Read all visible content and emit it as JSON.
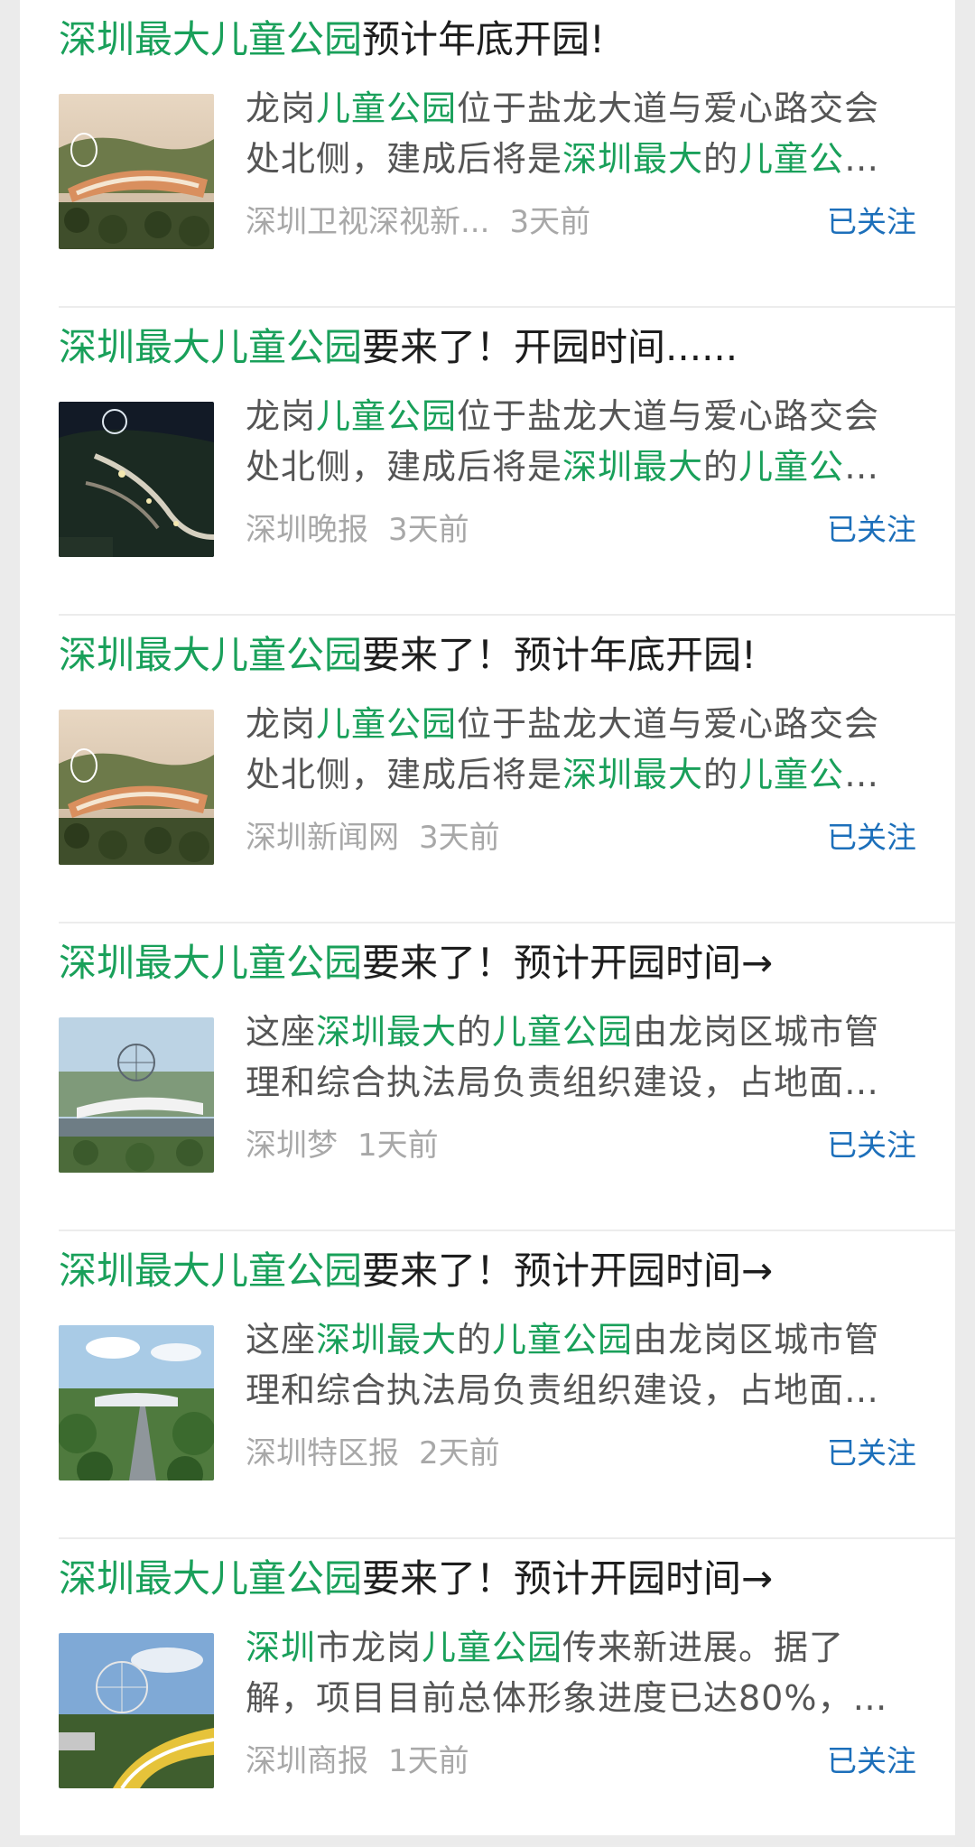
{
  "colors": {
    "highlight": "#19a05a",
    "follow": "#1c6fba",
    "source": "#a8a8a8"
  },
  "results": [
    {
      "title": {
        "highlight": "深圳最大儿童公园",
        "rest": "预计年底开园!"
      },
      "summary": {
        "line1": [
          {
            "t": "龙岗",
            "h": false
          },
          {
            "t": "儿童公园",
            "h": true
          },
          {
            "t": "位于盐龙大道与爱心路交会",
            "h": false
          }
        ],
        "line2": [
          {
            "t": "处北侧，建成后将是",
            "h": false
          },
          {
            "t": "深圳最大",
            "h": true
          },
          {
            "t": "的",
            "h": false
          },
          {
            "t": "儿童公",
            "h": true
          },
          {
            "t": "…",
            "h": false
          }
        ]
      },
      "source": "深圳卫视深视新...",
      "time": "3天前",
      "follow_label": "已关注",
      "thumbnail": "aerial-stadium-rendering-icon"
    },
    {
      "title": {
        "highlight": "深圳最大儿童公园",
        "rest": "要来了！开园时间......"
      },
      "summary": {
        "line1": [
          {
            "t": "龙岗",
            "h": false
          },
          {
            "t": "儿童公园",
            "h": true
          },
          {
            "t": "位于盐龙大道与爱心路交会",
            "h": false
          }
        ],
        "line2": [
          {
            "t": "处北侧，建成后将是",
            "h": false
          },
          {
            "t": "深圳最大",
            "h": true
          },
          {
            "t": "的",
            "h": false
          },
          {
            "t": "儿童公",
            "h": true
          },
          {
            "t": "…",
            "h": false
          }
        ]
      },
      "source": "深圳晚报",
      "time": "3天前",
      "follow_label": "已关注",
      "thumbnail": "night-aerial-park-icon"
    },
    {
      "title": {
        "highlight": "深圳最大儿童公园",
        "rest": "要来了！预计年底开园!"
      },
      "summary": {
        "line1": [
          {
            "t": "龙岗",
            "h": false
          },
          {
            "t": "儿童公园",
            "h": true
          },
          {
            "t": "位于盐龙大道与爱心路交会",
            "h": false
          }
        ],
        "line2": [
          {
            "t": "处北侧，建成后将是",
            "h": false
          },
          {
            "t": "深圳最大",
            "h": true
          },
          {
            "t": "的",
            "h": false
          },
          {
            "t": "儿童公",
            "h": true
          },
          {
            "t": "…",
            "h": false
          }
        ]
      },
      "source": "深圳新闻网",
      "time": "3天前",
      "follow_label": "已关注",
      "thumbnail": "aerial-stadium-rendering-icon"
    },
    {
      "title": {
        "highlight": "深圳最大儿童公园",
        "rest": "要来了！预计开园时间→"
      },
      "summary": {
        "line1": [
          {
            "t": "这座",
            "h": false
          },
          {
            "t": "深圳最大",
            "h": true
          },
          {
            "t": "的",
            "h": false
          },
          {
            "t": "儿童公园",
            "h": true
          },
          {
            "t": "由龙岗区城市管",
            "h": false
          }
        ],
        "line2": [
          {
            "t": "理和综合执法局负责组织建设，占地面…",
            "h": false
          }
        ]
      },
      "source": "深圳梦",
      "time": "1天前",
      "follow_label": "已关注",
      "thumbnail": "ferris-wheel-photo-icon"
    },
    {
      "title": {
        "highlight": "深圳最大儿童公园",
        "rest": "要来了！预计开园时间→"
      },
      "summary": {
        "line1": [
          {
            "t": "这座",
            "h": false
          },
          {
            "t": "深圳最大",
            "h": true
          },
          {
            "t": "的",
            "h": false
          },
          {
            "t": "儿童公园",
            "h": true
          },
          {
            "t": "由龙岗区城市管",
            "h": false
          }
        ],
        "line2": [
          {
            "t": "理和综合执法局负责组织建设，占地面…",
            "h": false
          }
        ]
      },
      "source": "深圳特区报",
      "time": "2天前",
      "follow_label": "已关注",
      "thumbnail": "park-road-photo-icon"
    },
    {
      "title": {
        "highlight": "深圳最大儿童公园",
        "rest": "要来了！预计开园时间→"
      },
      "summary": {
        "line1": [
          {
            "t": "深圳",
            "h": true
          },
          {
            "t": "市龙岗",
            "h": false
          },
          {
            "t": "儿童公园",
            "h": true
          },
          {
            "t": "传来新进展。据了",
            "h": false
          }
        ],
        "line2": [
          {
            "t": "解，项目目前总体形象进度已达80%，…",
            "h": false
          }
        ]
      },
      "source": "深圳商报",
      "time": "1天前",
      "follow_label": "已关注",
      "thumbnail": "ferris-wheel-construction-photo-icon"
    }
  ]
}
